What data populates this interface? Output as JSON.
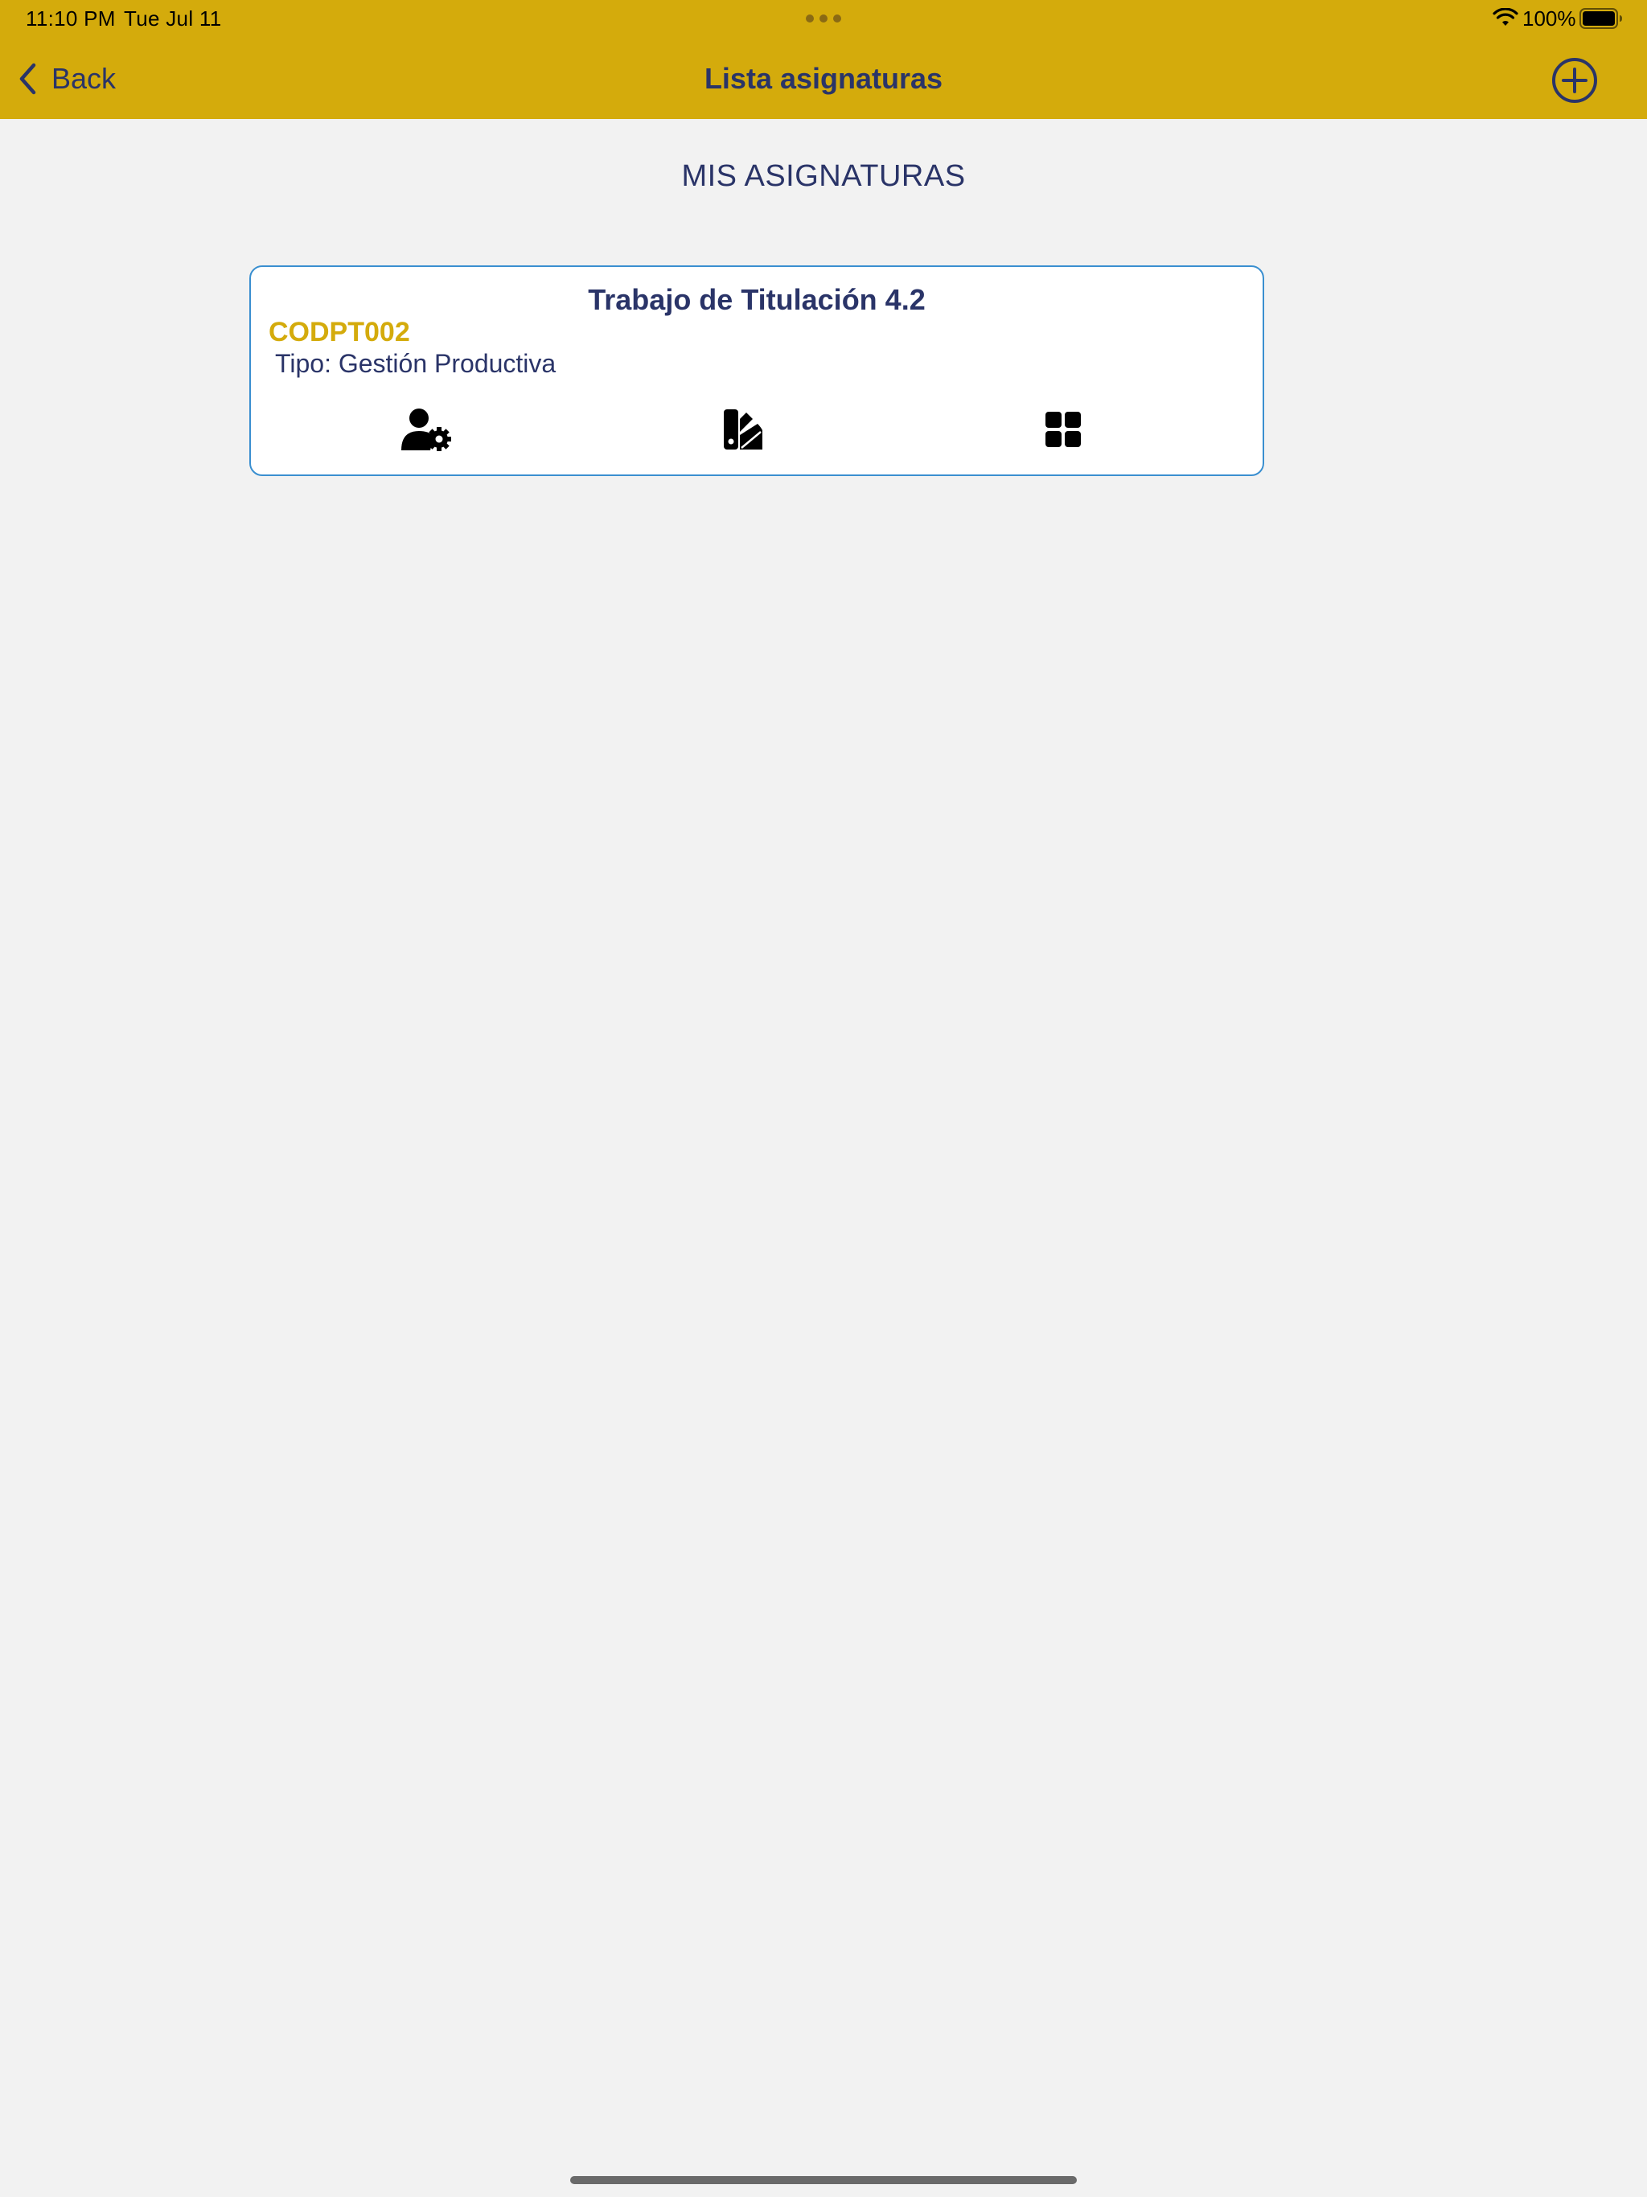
{
  "status_bar": {
    "time": "11:10 PM",
    "date": "Tue Jul 11",
    "battery_percent": "100%",
    "icons": [
      "wifi-icon",
      "battery-icon"
    ]
  },
  "nav": {
    "back_label": "Back",
    "title": "Lista asignaturas",
    "add_icon": "plus-circle-icon"
  },
  "section": {
    "title": "MIS ASIGNATURAS"
  },
  "courses": [
    {
      "name": "Trabajo de Titulación 4.2",
      "code": "CODPT002",
      "type": "Tipo: Gestión Productiva",
      "actions": [
        "user-gear-icon",
        "swatchbook-icon",
        "grid-icon"
      ]
    }
  ],
  "colors": {
    "header_bg": "#d4ab0c",
    "primary_text": "#2a3468",
    "code_text": "#d4ab0c",
    "card_border": "#3a8fd0",
    "page_bg": "#f2f2f2"
  }
}
